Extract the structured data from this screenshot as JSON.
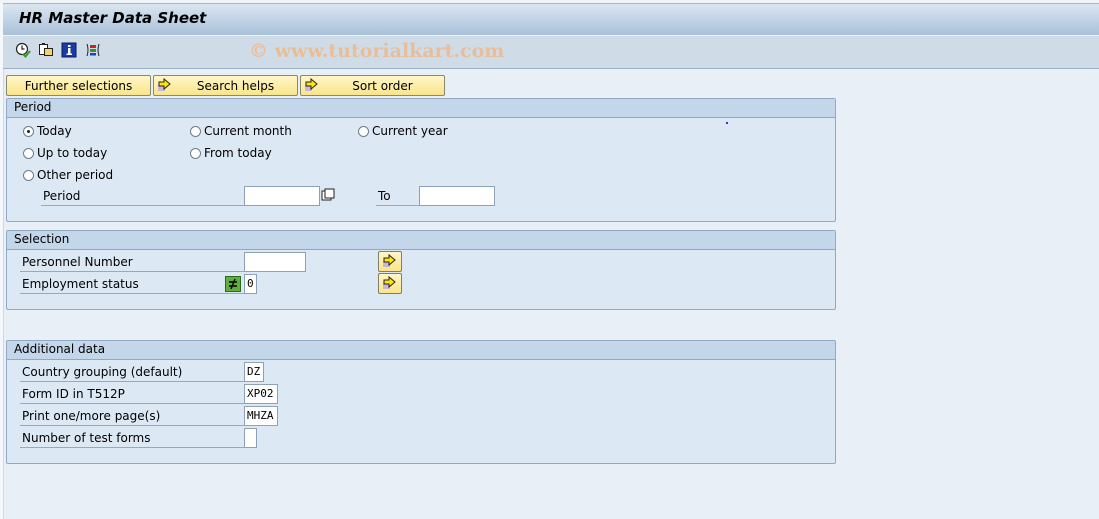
{
  "title": "HR Master Data Sheet",
  "watermark": "© www.tutorialkart.com",
  "toolbar": {
    "icons": [
      "execute-icon",
      "get-variant-icon",
      "program-info-icon",
      "selection-options-icon"
    ]
  },
  "buttons": {
    "further_selections": "Further selections",
    "search_helps": "Search helps",
    "sort_order": "Sort order"
  },
  "period": {
    "header": "Period",
    "options": {
      "today": "Today",
      "current_month": "Current month",
      "current_year": "Current year",
      "up_to_today": "Up to today",
      "from_today": "From today",
      "other_period": "Other period"
    },
    "selected": "today",
    "period_label": "Period",
    "period_value": "",
    "to_label": "To",
    "to_value": ""
  },
  "selection": {
    "header": "Selection",
    "personnel_number_label": "Personnel Number",
    "personnel_number_value": "",
    "employment_status_label": "Employment status",
    "employment_status_value": "0"
  },
  "additional": {
    "header": "Additional data",
    "country_grouping_label": "Country grouping (default)",
    "country_grouping_value": "DZ",
    "form_id_label": "Form ID in T512P",
    "form_id_value": "XP02",
    "print_pages_label": "Print one/more page(s)",
    "print_pages_value": "MHZA",
    "test_forms_label": "Number of test forms",
    "test_forms_value": ""
  }
}
